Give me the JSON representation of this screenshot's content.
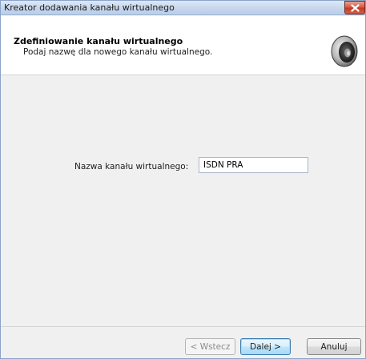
{
  "window": {
    "title": "Kreator dodawania kanału wirtualnego"
  },
  "header": {
    "title": "Zdefiniowanie kanału wirtualnego",
    "subtitle": "Podaj nazwę dla nowego kanału wirtualnego.",
    "icon": "speaker-icon"
  },
  "form": {
    "name_label": "Nazwa kanału wirtualnego:",
    "name_value": "ISDN PRA"
  },
  "footer": {
    "back_label": "< Wstecz",
    "next_label": "Dalej >",
    "cancel_label": "Anuluj"
  },
  "colors": {
    "close_button": "#c13b25",
    "default_button_border": "#3c7fb1"
  }
}
